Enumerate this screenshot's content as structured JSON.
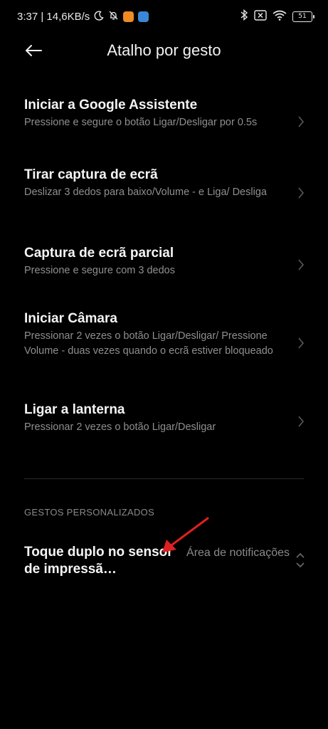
{
  "status_bar": {
    "time_speed": "3:37 | 14,6KB/s",
    "battery": "51",
    "icons": [
      "moon-icon",
      "notifications-off-icon",
      "app-icon-orange",
      "app-icon-blue",
      "bluetooth-icon",
      "sim-x-icon",
      "wifi-icon",
      "battery-icon"
    ],
    "badge_colors": [
      "#f08a24",
      "#3a86d9"
    ]
  },
  "header": {
    "title": "Atalho por gesto",
    "back_icon": "back-arrow-icon"
  },
  "items": [
    {
      "title": "Iniciar a Google Assistente",
      "desc": "Pressione e segure o botão Ligar/Desligar por 0.5s"
    },
    {
      "title": "Tirar captura de ecrã",
      "desc": "Deslizar 3 dedos para baixo/Volume - e Liga/ Desliga"
    },
    {
      "title": "Captura de ecrã parcial",
      "desc": "Pressione e segure com 3 dedos"
    },
    {
      "title": "Iniciar Câmara",
      "desc": "Pressionar 2 vezes o botão Ligar/Desligar/ Pressione Volume - duas vezes quando o ecrã estiver bloqueado"
    },
    {
      "title": "Ligar a lanterna",
      "desc": "Pressionar 2 vezes o botão Ligar/Desligar"
    }
  ],
  "section": {
    "header": "GESTOS PERSONALIZADOS",
    "item_title": "Toque duplo no sensor de impressã…",
    "item_value": "Área de notificações"
  },
  "colors": {
    "background": "#000000",
    "title_text": "#f5f5f5",
    "secondary_text": "#8f8f8f",
    "annotation_arrow": "#e02020"
  }
}
